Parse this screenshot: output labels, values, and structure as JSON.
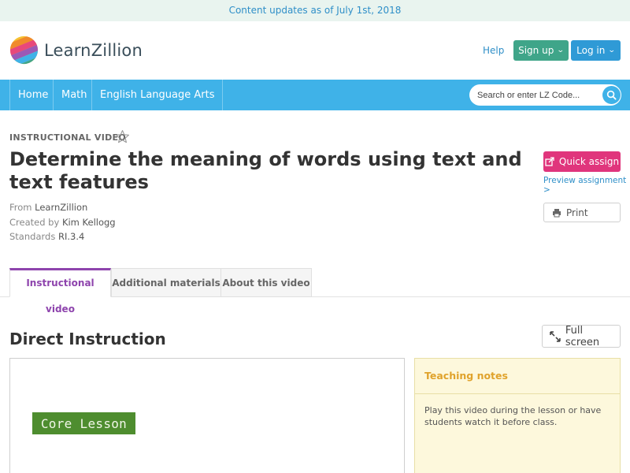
{
  "banner": {
    "text": "Content updates as of July 1st, 2018"
  },
  "header": {
    "logo_text": "LearnZillion",
    "help_label": "Help",
    "signup_label": "Sign up",
    "login_label": "Log in"
  },
  "nav": {
    "items": [
      {
        "label": "Home"
      },
      {
        "label": "Math"
      },
      {
        "label": "English Language Arts"
      }
    ],
    "search_placeholder": "Search or enter LZ Code..."
  },
  "content": {
    "kicker": "INSTRUCTIONAL VIDEO",
    "title": "Determine the meaning of words using text and text features",
    "from_label": "From",
    "from_value": "LearnZillion",
    "created_label": "Created by",
    "created_value": "Kim Kellogg",
    "standards_label": "Standards",
    "standards_value": "RI.3.4"
  },
  "actions": {
    "quick_assign": "Quick assign",
    "preview_link": "Preview assignment >",
    "print": "Print"
  },
  "tabs": [
    {
      "label": "Instructional video",
      "active": true
    },
    {
      "label": "Additional materials",
      "active": false
    },
    {
      "label": "About this video",
      "active": false
    }
  ],
  "section": {
    "title": "Direct Instruction",
    "fullscreen_label": "Full screen"
  },
  "video": {
    "core_lesson_label": "Core Lesson"
  },
  "notes": {
    "title": "Teaching notes",
    "body": "Play this video during the lesson or have students watch it before class."
  },
  "colors": {
    "nav_blue": "#3fb2e8",
    "signup_green": "#3fa589",
    "login_blue": "#2f9ad6",
    "quick_assign_pink": "#e0357c",
    "tab_active_purple": "#8e44ad",
    "notes_yellow": "#fdf8dc",
    "notes_title_orange": "#e0a32c",
    "core_lesson_green": "#4e8d2f"
  }
}
